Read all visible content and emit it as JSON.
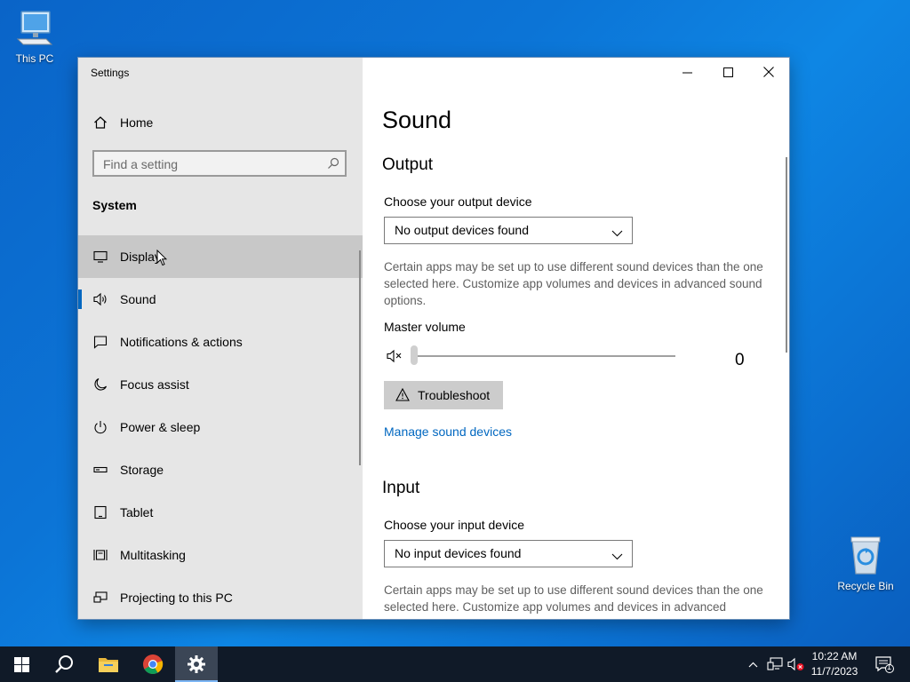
{
  "desktop": {
    "this_pc_label": "This PC",
    "recycle_bin_label": "Recycle Bin"
  },
  "window": {
    "title": "Settings",
    "controls": {
      "minimize": "minimize-icon",
      "maximize": "maximize-icon",
      "close": "close-icon"
    }
  },
  "sidebar": {
    "home_label": "Home",
    "search_placeholder": "Find a setting",
    "section_label": "System",
    "items": [
      {
        "label": "Display",
        "icon": "display-icon",
        "state": "hover"
      },
      {
        "label": "Sound",
        "icon": "sound-icon",
        "state": "selected"
      },
      {
        "label": "Notifications & actions",
        "icon": "notifications-icon",
        "state": ""
      },
      {
        "label": "Focus assist",
        "icon": "moon-icon",
        "state": ""
      },
      {
        "label": "Power & sleep",
        "icon": "power-icon",
        "state": ""
      },
      {
        "label": "Storage",
        "icon": "storage-icon",
        "state": ""
      },
      {
        "label": "Tablet",
        "icon": "tablet-icon",
        "state": ""
      },
      {
        "label": "Multitasking",
        "icon": "multitasking-icon",
        "state": ""
      },
      {
        "label": "Projecting to this PC",
        "icon": "projecting-icon",
        "state": ""
      }
    ]
  },
  "main": {
    "title": "Sound",
    "output": {
      "heading": "Output",
      "device_label": "Choose your output device",
      "device_value": "No output devices found",
      "description": "Certain apps may be set up to use different sound devices than the one selected here. Customize app volumes and devices in advanced sound options.",
      "master_volume_label": "Master volume",
      "master_volume_value": "0",
      "master_volume_level": 0,
      "troubleshoot_label": "Troubleshoot",
      "manage_link": "Manage sound devices"
    },
    "input": {
      "heading": "Input",
      "device_label": "Choose your input device",
      "device_value": "No input devices found",
      "description": "Certain apps may be set up to use different sound devices than the one selected here. Customize app volumes and devices in advanced"
    }
  },
  "taskbar": {
    "time": "10:22 AM",
    "date": "11/7/2023",
    "notification_count": "1"
  },
  "colors": {
    "accent": "#0067c0",
    "desktop": "#0c74d6",
    "taskbar": "#101a28",
    "sidebar": "#e6e6e6"
  }
}
